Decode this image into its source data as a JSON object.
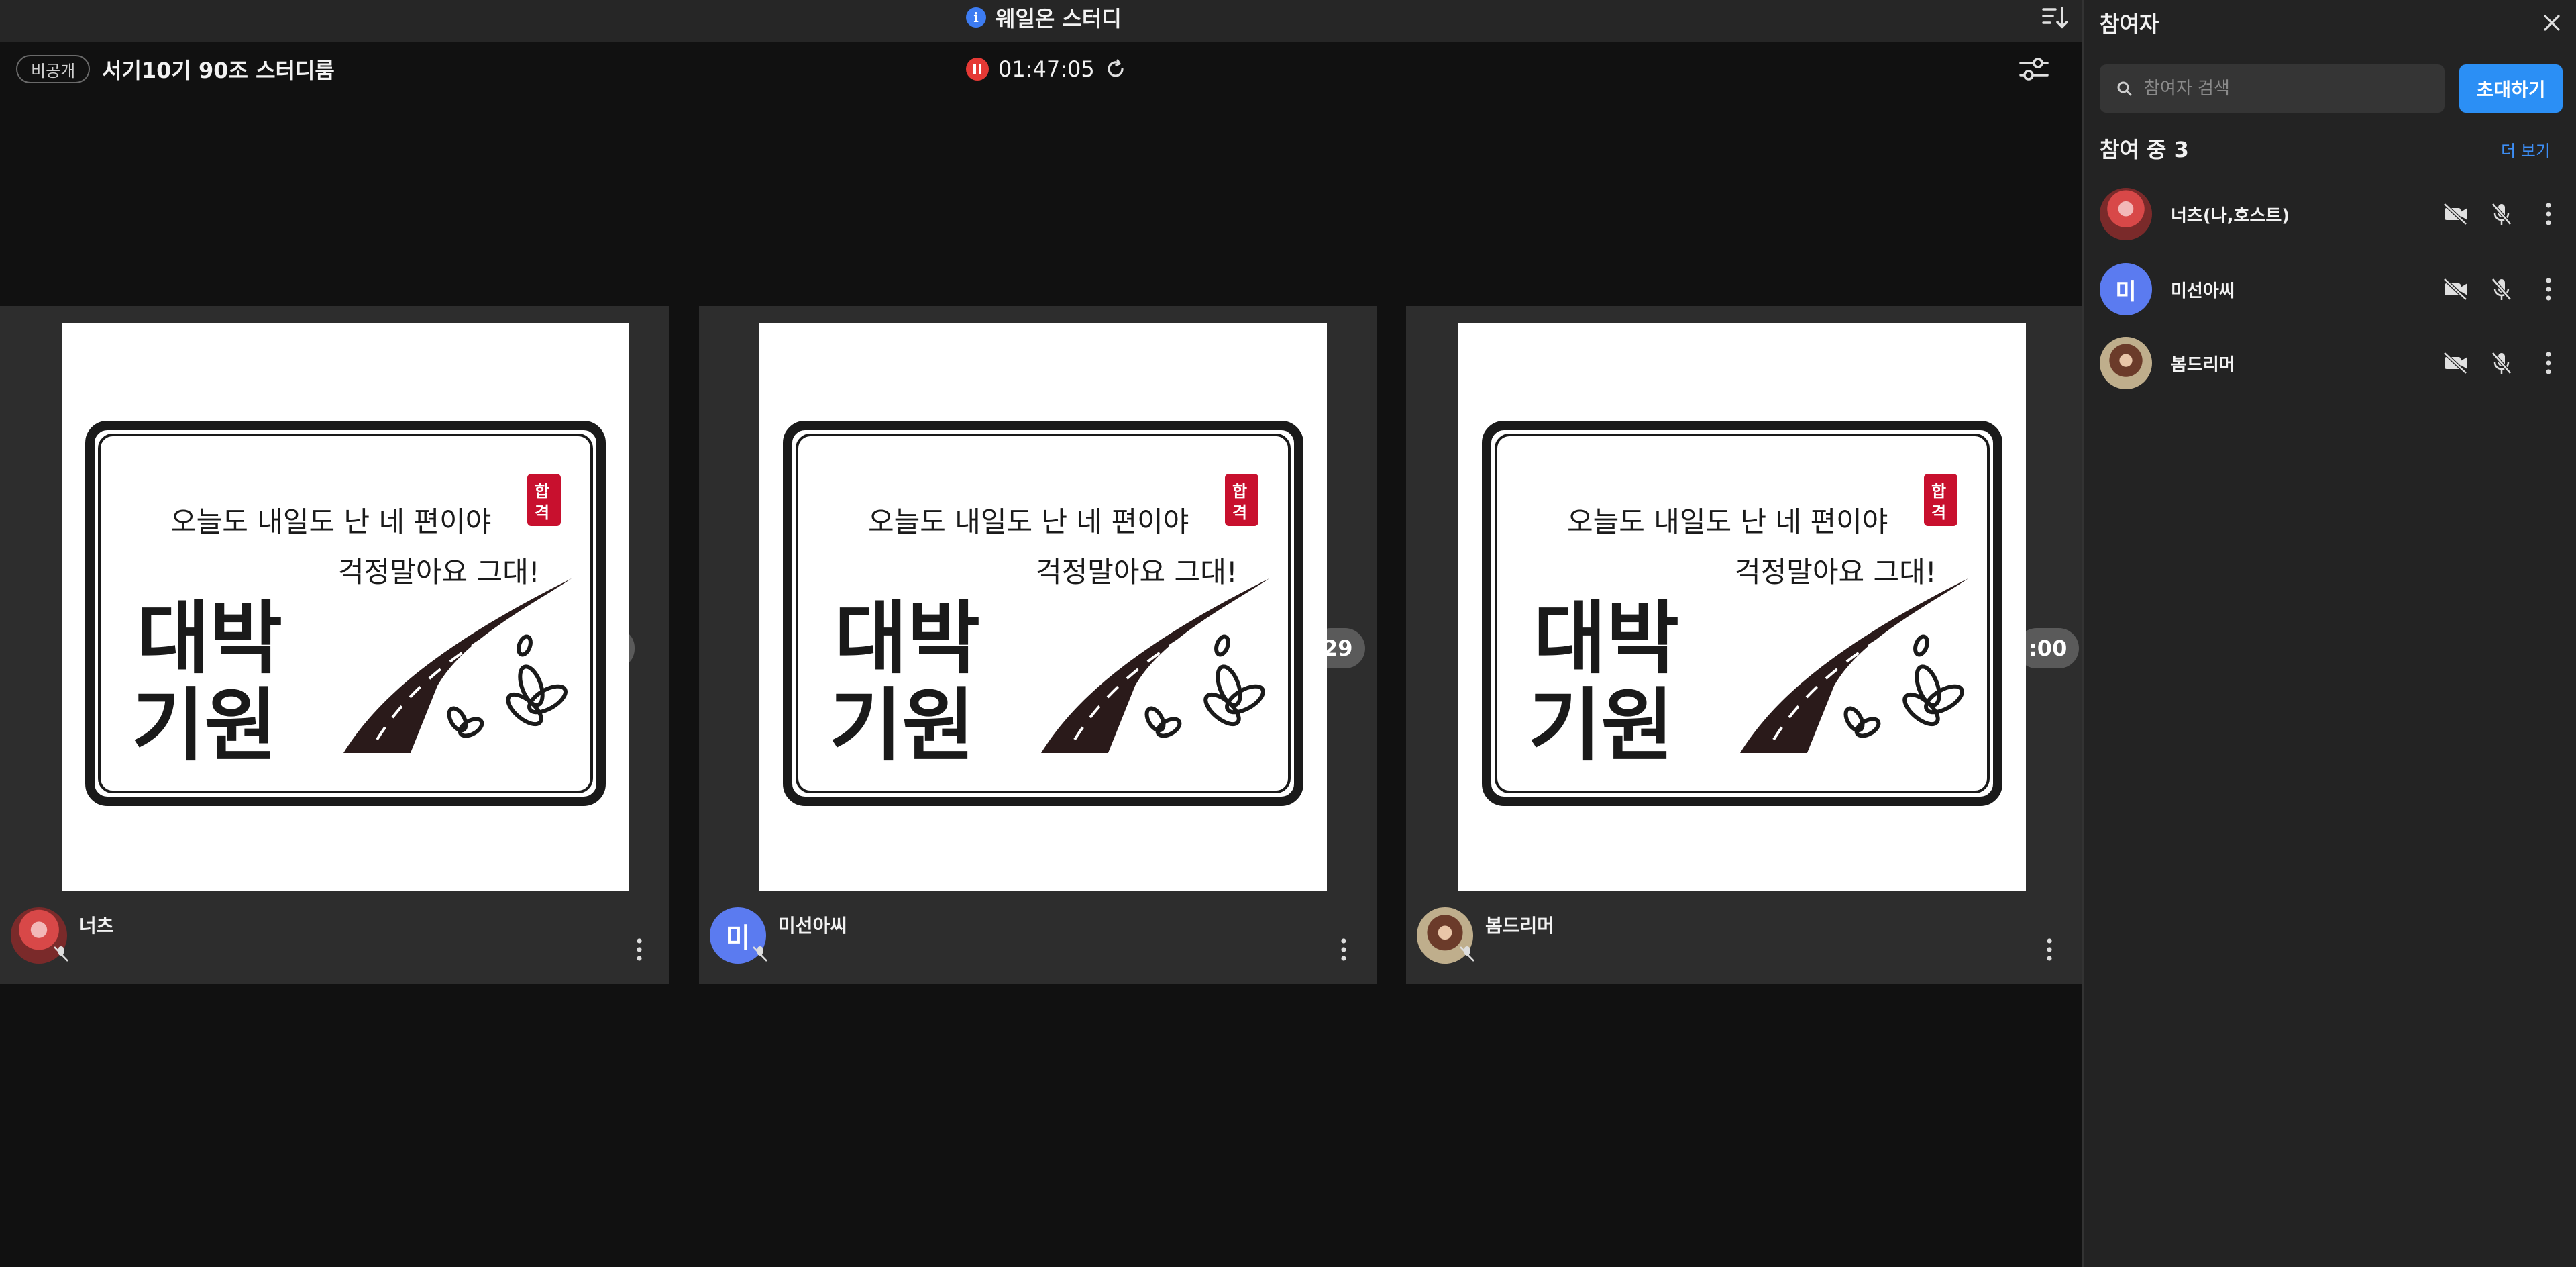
{
  "topbar": {
    "app_title": "웨일온 스터디",
    "info_icon": "i"
  },
  "header": {
    "private_badge": "비공개",
    "room_title": "서기10기 90조 스터디룸",
    "timer": "01:47:05"
  },
  "tiles": [
    {
      "name": "너츠",
      "clock_fragment": "5",
      "avatar": "photo"
    },
    {
      "name": "미선아씨",
      "clock_fragment": "29",
      "avatar": "미"
    },
    {
      "name": "봄드리머",
      "clock_fragment": ":00",
      "avatar": "photo"
    }
  ],
  "poster": {
    "line1": "오늘도 내일도 난 네 편이야",
    "line2": "걱정말아요 그대!",
    "big1": "대박",
    "big2": "기원",
    "seal1": "합",
    "seal2": "격"
  },
  "panel": {
    "title": "참여자",
    "search_placeholder": "참여자 검색",
    "invite_label": "초대하기",
    "count_label": "참여 중 3",
    "more_label": "더 보기",
    "participants": [
      {
        "name": "너츠(나,호스트)",
        "avatar": "photo"
      },
      {
        "name": "미선아씨",
        "avatar": "미"
      },
      {
        "name": "봄드리머",
        "avatar": "photo"
      }
    ]
  },
  "colors": {
    "accent": "#2b8ff5",
    "recording": "#e53935",
    "avatar_letter_bg": "#5b7bf0"
  }
}
